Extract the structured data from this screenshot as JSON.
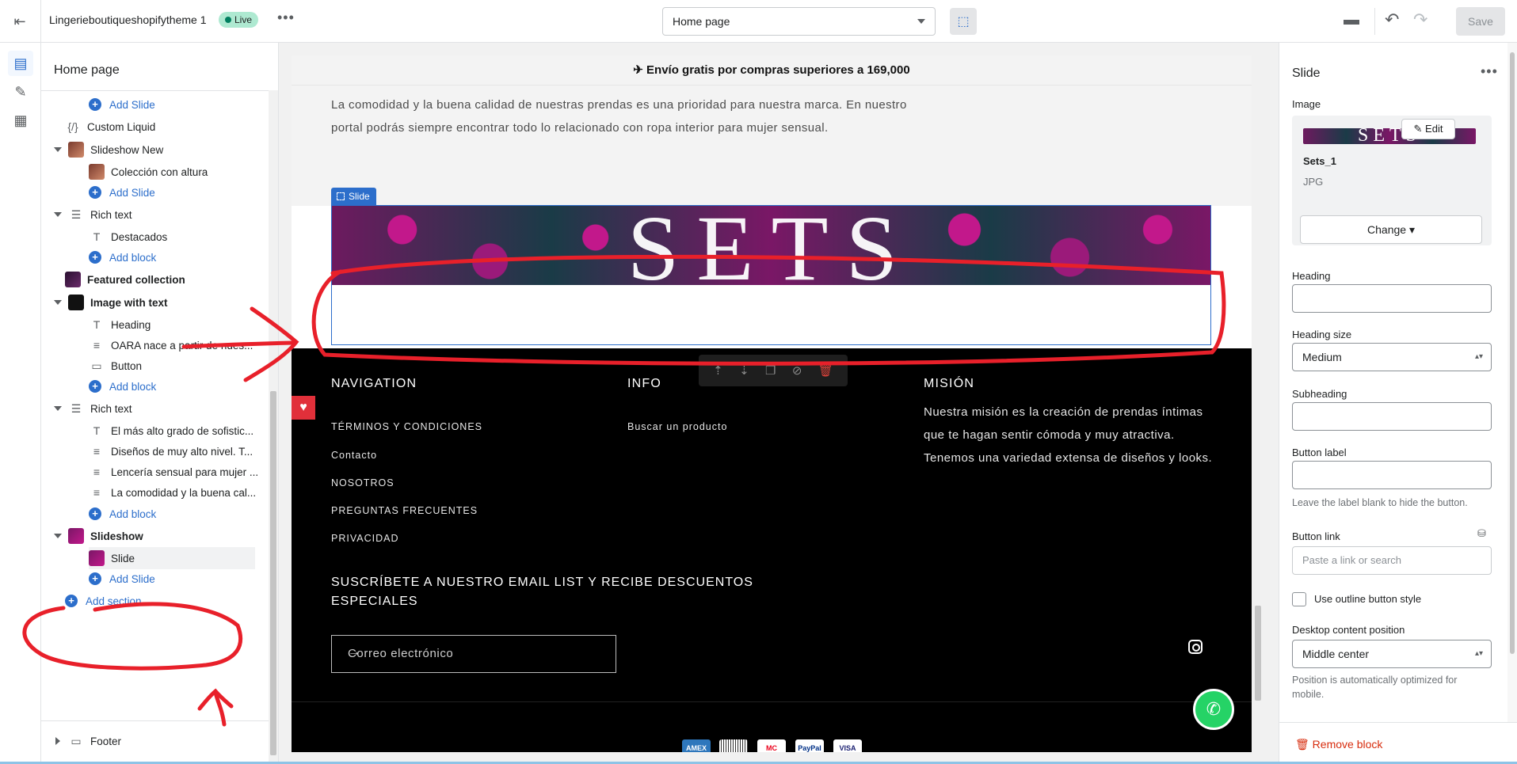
{
  "topbar": {
    "theme_name": "Lingerieboutiqueshopifytheme 1",
    "status": "Live",
    "page_selector": "Home page",
    "save_label": "Save"
  },
  "sections_panel": {
    "title": "Home page",
    "rows": [
      {
        "label": "Add Slide",
        "kind": "add"
      },
      {
        "label": "Custom Liquid",
        "kind": "section",
        "icon": "code-icon"
      },
      {
        "label": "Slideshow New",
        "kind": "section",
        "icon": "image-thumb"
      },
      {
        "label": "Colección con altura",
        "kind": "block",
        "icon": "image-thumb"
      },
      {
        "label": "Add Slide",
        "kind": "add"
      },
      {
        "label": "Rich text",
        "kind": "section",
        "icon": "text-block-icon"
      },
      {
        "label": "Destacados",
        "kind": "block",
        "icon": "type-icon"
      },
      {
        "label": "Add block",
        "kind": "add"
      },
      {
        "label": "Featured collection",
        "kind": "section",
        "icon": "image-thumb"
      },
      {
        "label": "Image with text",
        "kind": "section",
        "icon": "image-thumb"
      },
      {
        "label": "Heading",
        "kind": "block",
        "icon": "type-icon"
      },
      {
        "label": "OARA nace a partir de nues...",
        "kind": "block",
        "icon": "paragraph-icon"
      },
      {
        "label": "Button",
        "kind": "block",
        "icon": "button-icon"
      },
      {
        "label": "Add block",
        "kind": "add"
      },
      {
        "label": "Rich text",
        "kind": "section",
        "icon": "text-block-icon"
      },
      {
        "label": "El más alto grado de sofistic...",
        "kind": "block",
        "icon": "type-icon"
      },
      {
        "label": "Diseños de muy alto nivel. T...",
        "kind": "block",
        "icon": "paragraph-icon"
      },
      {
        "label": "Lencería sensual para mujer ...",
        "kind": "block",
        "icon": "paragraph-icon"
      },
      {
        "label": "La comodidad y la buena cal...",
        "kind": "block",
        "icon": "paragraph-icon"
      },
      {
        "label": "Add block",
        "kind": "add"
      },
      {
        "label": "Slideshow",
        "kind": "section",
        "icon": "image-thumb"
      },
      {
        "label": "Slide",
        "kind": "block",
        "icon": "image-thumb"
      },
      {
        "label": "Add Slide",
        "kind": "add"
      }
    ],
    "add_section": "Add section",
    "footer_label": "Footer"
  },
  "preview": {
    "announcement": "✈ Envío gratis por compras superiores a 169,000",
    "rich_text": "La comodidad y la buena calidad de nuestras prendas es una prioridad para nuestra marca. En nuestro portal podrás siempre encontrar todo lo relacionado con ropa interior para mujer sensual.",
    "slide_tag": "Slide",
    "banner_text": "SETS",
    "footer": {
      "nav_title": "NAVIGATION",
      "nav_links": [
        "TÉRMINOS Y CONDICIONES",
        "Contacto",
        "NOSOTROS",
        "PREGUNTAS FRECUENTES",
        "PRIVACIDAD"
      ],
      "info_title": "INFO",
      "info_links": [
        "Buscar un producto"
      ],
      "mission_title": "MISIÓN",
      "mission_text": "Nuestra misión es la creación de prendas íntimas que te hagan sentir cómoda y muy atractiva. Tenemos una variedad extensa de diseños y looks.",
      "subscribe_title": "SUSCRÍBETE A NUESTRO EMAIL LIST Y RECIBE DESCUENTOS ESPECIALES",
      "email_placeholder": "Correo electrónico",
      "payments": [
        "AMEX",
        "",
        "MC",
        "PayPal",
        "VISA"
      ]
    }
  },
  "settings": {
    "title": "Slide",
    "image_label": "Image",
    "edit_label": "Edit",
    "file_name": "Sets_1",
    "file_type": "JPG",
    "change_label": "Change",
    "heading_label": "Heading",
    "heading_size_label": "Heading size",
    "heading_size_value": "Medium",
    "subheading_label": "Subheading",
    "button_label_label": "Button label",
    "button_label_help": "Leave the label blank to hide the button.",
    "button_link_label": "Button link",
    "button_link_placeholder": "Paste a link or search",
    "outline_label": "Use outline button style",
    "desktop_position_label": "Desktop content position",
    "desktop_position_value": "Middle center",
    "desktop_position_help": "Position is automatically optimized for mobile.",
    "remove_label": "Remove block"
  },
  "colors": {
    "accent": "#2c6ecb",
    "annotation": "#e8202a",
    "danger": "#d72c0d"
  }
}
